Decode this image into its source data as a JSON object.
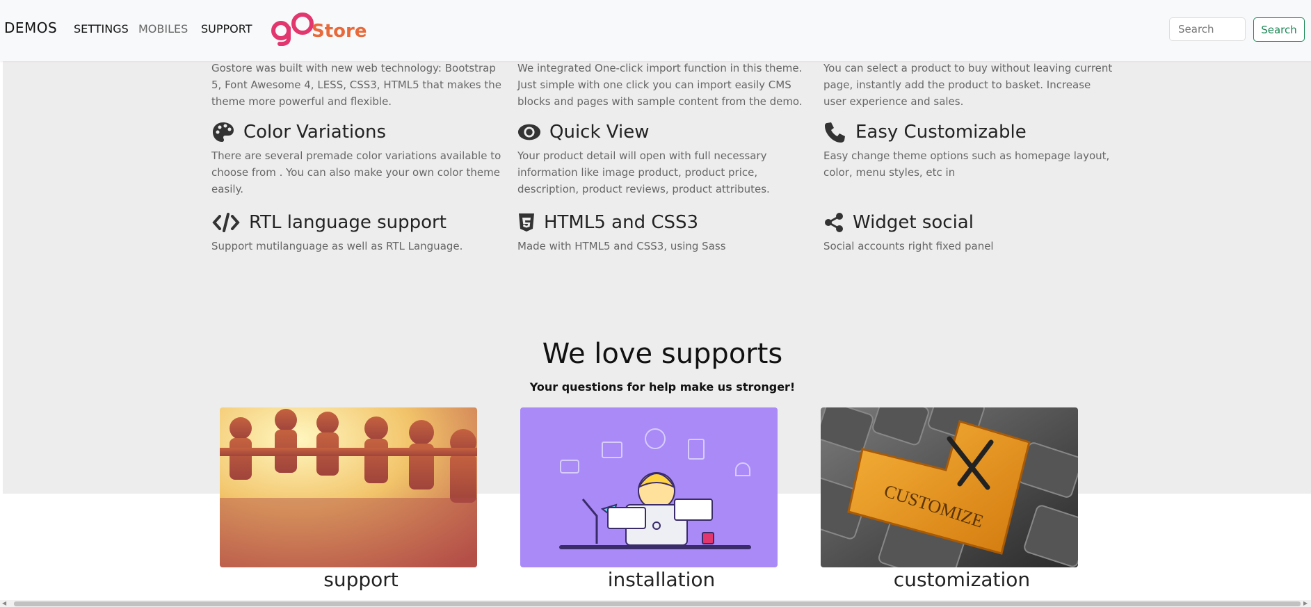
{
  "navbar": {
    "brand": "DEMOS",
    "links": [
      "SETTINGS",
      "MOBILES",
      "SUPPORT"
    ],
    "logo_text": "Store",
    "search_placeholder": "Search",
    "search_button": "Search"
  },
  "top_descriptions": [
    "Gostore was built with new web technology: Bootstrap 5, Font Awesome 4, LESS, CSS3, HTML5 that makes the theme more powerful and flexible.",
    "We integrated One-click import function in this theme. Just simple with one click you can import easily CMS blocks and pages with sample content from the demo.",
    "You can select a product to buy without leaving current page, instantly add the product to basket. Increase user experience and sales."
  ],
  "features": [
    {
      "icon": "palette-icon",
      "title": "Color Variations",
      "text": "There are several premade color variations available to choose from . You can also make your own color theme easily."
    },
    {
      "icon": "eye-icon",
      "title": "Quick View",
      "text": "Your product detail will open with full necessary information like image product, product price, description, product reviews, product attributes."
    },
    {
      "icon": "phone-icon",
      "title": "Easy Customizable",
      "text": "Easy change theme options such as homepage layout, color, menu styles, etc in"
    },
    {
      "icon": "code-icon",
      "title": "RTL language support",
      "text": "Support mutilanguage as well as RTL Language."
    },
    {
      "icon": "html5-icon",
      "title": "HTML5 and CSS3",
      "text": "Made with HTML5 and CSS3, using Sass"
    },
    {
      "icon": "share-icon",
      "title": "Widget social",
      "text": "Social accounts right fixed panel"
    }
  ],
  "support": {
    "title": "We love supports",
    "subtitle": "Your questions for help make us stronger!",
    "cards": [
      {
        "label": "support",
        "image": "paper-people-chain"
      },
      {
        "label": "installation",
        "image": "woman-at-laptop-illustration"
      },
      {
        "label": "customization",
        "image": "customize-keyboard-key"
      }
    ]
  },
  "colors": {
    "logo_pink": "#e2366f",
    "logo_orange": "#e8693a",
    "search_green": "#198754",
    "section_gray": "#eeeded"
  }
}
